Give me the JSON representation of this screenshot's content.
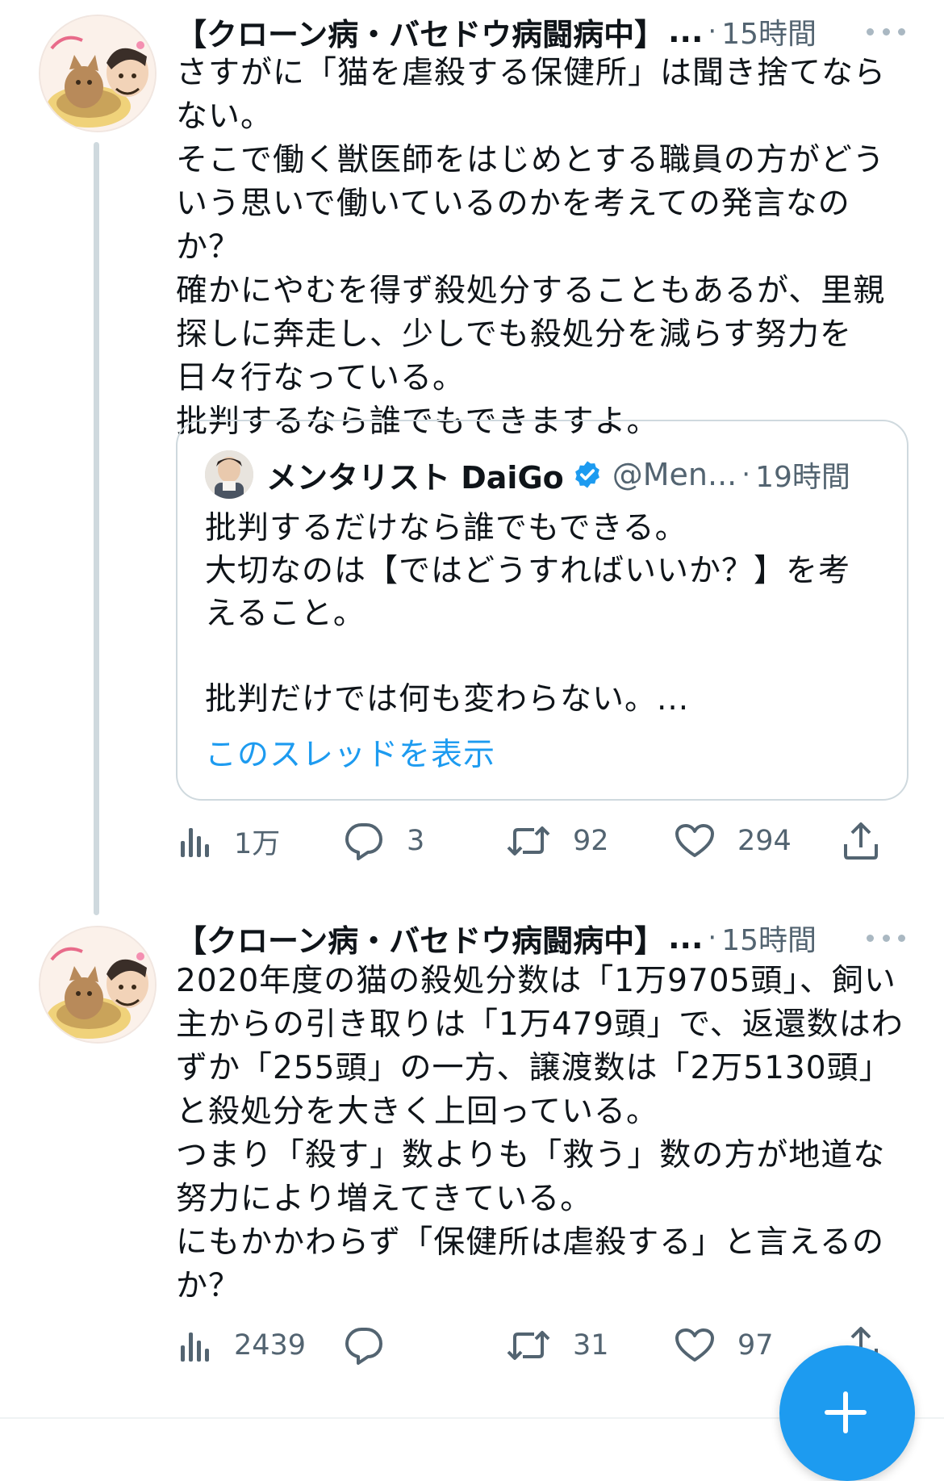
{
  "tweets": [
    {
      "author_name": "【クローン病・バセドウ病闘病中】",
      "ellipsis": "...",
      "separator": "·",
      "time": "15時間",
      "body": [
        "さすがに「猫を虐殺する保健所」は聞き捨てならない。",
        "そこで働く獣医師をはじめとする職員の方がどういう思いで働いているのかを考えての発言なのか？",
        "確かにやむを得ず殺処分することもあるが、里親探しに奔走し、少しでも殺処分を減らす努力を日々行なっている。",
        "批判するなら誰でもできますよ。"
      ],
      "quote": {
        "name": "メンタリスト DaiGo",
        "handle": "@Men...",
        "separator": "·",
        "time": "19時間",
        "body": [
          "批判するだけなら誰でもできる。",
          "大切なのは【ではどうすればいいか？】を考えること。",
          "",
          "批判だけでは何も変わらない。..."
        ],
        "show_thread": "このスレッドを表示"
      },
      "actions": {
        "views": "1万",
        "replies": "3",
        "retweets": "92",
        "likes": "294"
      }
    },
    {
      "author_name": "【クローン病・バセドウ病闘病中】",
      "ellipsis": "...",
      "separator": "·",
      "time": "15時間",
      "body": [
        "2020年度の猫の殺処分数は「1万9705頭」、飼い主からの引き取りは「1万479頭」で、返還数はわずか「255頭」の一方、譲渡数は「2万5130頭」と殺処分を大きく上回っている。",
        "つまり「殺す」数よりも「救う」数の方が地道な努力により増えてきている。",
        "にもかかわらず「保健所は虐殺する」と言えるのか？"
      ],
      "actions": {
        "views": "2439",
        "replies": "",
        "retweets": "31",
        "likes": "97"
      }
    }
  ],
  "colors": {
    "accent": "#1d9bf0",
    "secondary_text": "#536471",
    "thread_line": "#cfd9de"
  },
  "icons": [
    "views-icon",
    "reply-icon",
    "retweet-icon",
    "like-icon",
    "share-icon",
    "more-icon",
    "verified-icon",
    "compose-plus-icon"
  ]
}
